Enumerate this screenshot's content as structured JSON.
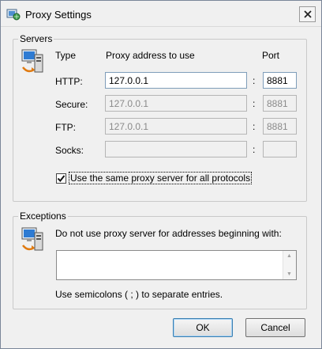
{
  "window": {
    "title": "Proxy Settings",
    "app_icon": "proxy-globe-icon",
    "close_icon": "close-x-icon"
  },
  "servers": {
    "legend": "Servers",
    "icon": "network-computer-icon",
    "headers": {
      "type": "Type",
      "address": "Proxy address to use",
      "port": "Port"
    },
    "rows": [
      {
        "label": "HTTP:",
        "address": "127.0.0.1",
        "port": "8881",
        "enabled": true
      },
      {
        "label": "Secure:",
        "address": "127.0.0.1",
        "port": "8881",
        "enabled": false
      },
      {
        "label": "FTP:",
        "address": "127.0.0.1",
        "port": "8881",
        "enabled": false
      },
      {
        "label": "Socks:",
        "address": "",
        "port": "",
        "enabled": false
      }
    ],
    "colon": ":",
    "same_proxy": {
      "label": "Use the same proxy server for all protocols",
      "checked": true
    }
  },
  "exceptions": {
    "legend": "Exceptions",
    "icon": "network-computer-icon",
    "description": "Do not use proxy server for addresses beginning with:",
    "value": "",
    "hint": "Use semicolons ( ; ) to separate entries."
  },
  "buttons": {
    "ok": "OK",
    "cancel": "Cancel"
  },
  "colors": {
    "field_border": "#7f9db9",
    "default_button": "#3c7fb1",
    "window_bg": "#f0f0f0"
  }
}
